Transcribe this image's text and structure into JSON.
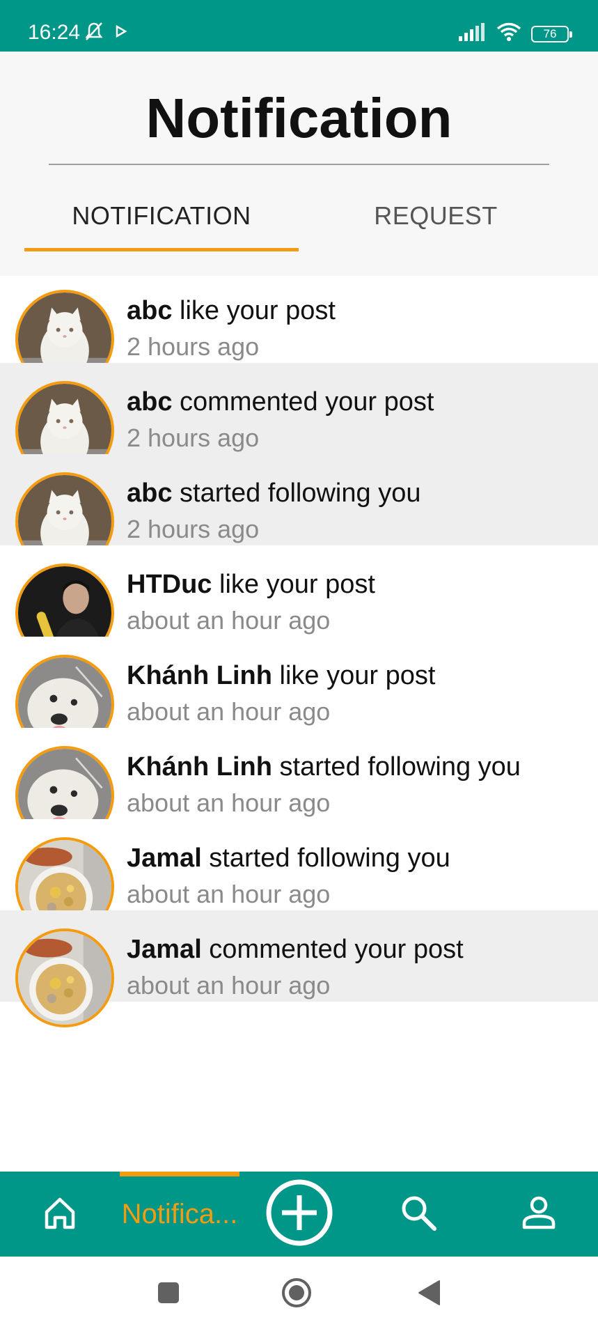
{
  "status_bar": {
    "time": "16:24",
    "battery": "76",
    "icons": [
      "bell-off-icon",
      "play-icon",
      "signal-icon",
      "wifi-icon",
      "battery-icon"
    ]
  },
  "header": {
    "title": "Notification",
    "tabs": [
      {
        "label": "NOTIFICATION",
        "active": true
      },
      {
        "label": "REQUEST",
        "active": false
      }
    ]
  },
  "notifications": [
    {
      "name": "abc",
      "action": " like your post",
      "time": "2 hours ago",
      "avatar": "white-cat",
      "shaded": false
    },
    {
      "name": "abc",
      "action": " commented your post",
      "time": "2 hours ago",
      "avatar": "white-cat",
      "shaded": true
    },
    {
      "name": "abc",
      "action": " started following you",
      "time": "2 hours ago",
      "avatar": "white-cat",
      "shaded": true
    },
    {
      "name": "HTDuc",
      "action": " like your post",
      "time": "about an hour ago",
      "avatar": "person-with-corn",
      "shaded": false
    },
    {
      "name": "Khánh Linh",
      "action": " like your post",
      "time": "about an hour ago",
      "avatar": "white-dog",
      "shaded": false
    },
    {
      "name": "Khánh Linh",
      "action": " started following you",
      "time": "about an hour ago",
      "avatar": "white-dog",
      "shaded": false
    },
    {
      "name": "Jamal",
      "action": " started following you",
      "time": "about an hour ago",
      "avatar": "food-plate",
      "shaded": false
    },
    {
      "name": "Jamal",
      "action": " commented your post",
      "time": "about an hour ago",
      "avatar": "food-plate",
      "shaded": true
    }
  ],
  "bottom_nav": {
    "items": [
      {
        "icon": "home-icon"
      },
      {
        "label": "Notifica...",
        "active": true
      },
      {
        "icon": "add-circle-icon"
      },
      {
        "icon": "search-icon"
      },
      {
        "icon": "profile-icon"
      }
    ]
  },
  "colors": {
    "primary": "#009688",
    "accent": "#f39c12",
    "shaded_row": "#eeeeee"
  }
}
